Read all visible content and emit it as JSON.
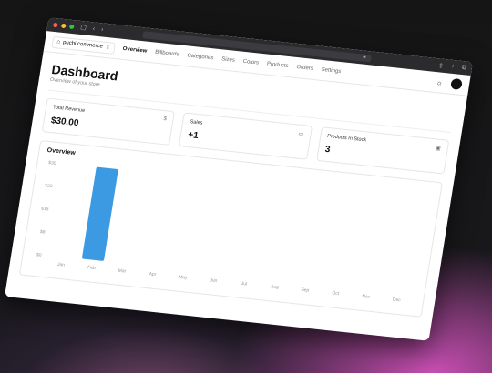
{
  "window": {
    "url_icon": "lock-icon"
  },
  "nav": {
    "store_name": "puchi commerce",
    "links": [
      "Overview",
      "Billboards",
      "Categories",
      "Sizes",
      "Colors",
      "Products",
      "Orders",
      "Settings"
    ],
    "active": "Overview"
  },
  "header": {
    "title": "Dashboard",
    "subtitle": "Overview of your store"
  },
  "cards": [
    {
      "label": "Total Revenue",
      "value": "$30.00",
      "icon": "dollar-icon"
    },
    {
      "label": "Sales",
      "value": "+1",
      "icon": "credit-card-icon"
    },
    {
      "label": "Products In Stock",
      "value": "3",
      "icon": "package-icon"
    }
  ],
  "overview": {
    "title": "Overview",
    "chart_data": {
      "type": "bar",
      "categories": [
        "Jan",
        "Feb",
        "Mar",
        "Apr",
        "May",
        "Jun",
        "Jul",
        "Aug",
        "Sep",
        "Oct",
        "Nov",
        "Dec"
      ],
      "values": [
        0,
        30,
        0,
        0,
        0,
        0,
        0,
        0,
        0,
        0,
        0,
        0
      ],
      "yticks": [
        "$0",
        "$8",
        "$15",
        "$23",
        "$30"
      ],
      "ylim": [
        0,
        30
      ],
      "bar_color": "#3b9ae1"
    }
  }
}
